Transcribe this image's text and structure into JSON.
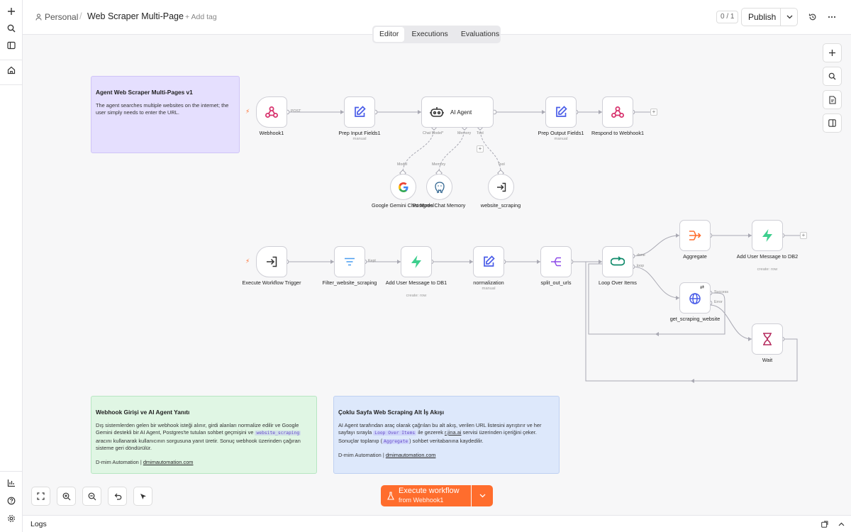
{
  "header": {
    "workspace": "Personal",
    "workflow_title": "Web Scraper Multi-Page",
    "add_tag": "+ Add tag",
    "counter": "0 / 1",
    "publish_label": "Publish"
  },
  "tabs": [
    {
      "label": "Editor",
      "active": true
    },
    {
      "label": "Executions",
      "active": false
    },
    {
      "label": "Evaluations",
      "active": false
    }
  ],
  "stickies": {
    "agent": {
      "title": "Agent Web Scraper Multi-Pages v1",
      "body": "The agent searches multiple websites on the internet; the user simply needs to enter the URL.",
      "color": "#e5dffe"
    },
    "webhook_note": {
      "title": "Webhook Girişi ve AI Agent Yanıtı",
      "body_1": "Dış sistemlerden gelen bir webhook isteği alınır, girdi alanları normalize edilir ve Google Gemini destekli bir AI Agent, Postgres'te tutulan sohbet geçmişini ve ",
      "code_1": "website_scraping",
      "body_2": " aracını kullanarak kullanıcının sorgusuna yanıt üretir. Sonuç webhook üzerinden çağıran sisteme geri döndürülür.",
      "signature": "D-mim Automation | ",
      "signature_link": "dmimautomation.com",
      "color": "#e0f6e4"
    },
    "scraping_note": {
      "title": "Çoklu Sayfa Web Scraping Alt İş Akışı",
      "body_1": "AI Agent tarafından araç olarak çağrılan bu alt akış, verilen URL listesini ayrıştırır ve her sayfayı sırayla ",
      "code_1": "Loop Over Items",
      "body_2": " ile gezerek ",
      "link": "r.jina.ai",
      "body_3": " servisi üzerinden içeriğini çeker. Sonuçlar toplanıp (",
      "code_2": "Aggregate",
      "body_4": ") sohbet veritabanına kaydedilir.",
      "signature": "D-mim Automation | ",
      "signature_link": "dmimautomation.com",
      "color": "#dde8fb"
    }
  },
  "nodes": {
    "webhook1": {
      "label": "Webhook1"
    },
    "prep_input": {
      "label": "Prep Input Fields1",
      "sub": "manual"
    },
    "ai_agent": {
      "label": "AI Agent"
    },
    "prep_output": {
      "label": "Prep Output Fields1",
      "sub": "manual"
    },
    "respond": {
      "label": "Respond to Webhook1"
    },
    "gemini": {
      "label": "Google Gemini Chat Model"
    },
    "postgres": {
      "label": "Postgres Chat Memory"
    },
    "website_scraping": {
      "label": "website_scraping"
    },
    "exec_trigger": {
      "label": "Execute Workflow Trigger"
    },
    "filter": {
      "label": "Filter_website_scraping"
    },
    "add_msg_db1": {
      "label": "Add User Message to DB1",
      "sub": "create: row"
    },
    "normalization": {
      "label": "normalization",
      "sub": "manual"
    },
    "split_out": {
      "label": "split_out_urls"
    },
    "loop": {
      "label": "Loop Over Items"
    },
    "aggregate": {
      "label": "Aggregate"
    },
    "add_msg_db2": {
      "label": "Add User Message to DB2",
      "sub": "create: row"
    },
    "get_scraping": {
      "label": "get_scraping_website"
    },
    "wait": {
      "label": "Wait"
    }
  },
  "wire_labels": {
    "post": "POST",
    "chat_model": "Chat Model*",
    "memory": "Memory",
    "tool": "Tool",
    "model": "Model",
    "memory_in": "Memory",
    "tool_in": "Tool",
    "kept": "Kept",
    "done": "done",
    "loop": "loop",
    "success": "Success",
    "error": "Error"
  },
  "execute": {
    "label": "Execute workflow",
    "sub": "from Webhook1"
  },
  "logs_label": "Logs",
  "colors": {
    "accent": "#ff6d2d",
    "webhook": "#d8356f",
    "edit": "#4a5de8",
    "supabase": "#3ecf8e",
    "split": "#8e4be8",
    "loop": "#0e8a6a",
    "wait": "#b52b5e"
  }
}
